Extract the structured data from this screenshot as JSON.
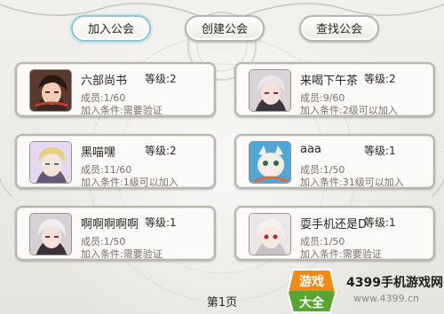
{
  "tabs": [
    {
      "label": "加入公会",
      "active": true
    },
    {
      "label": "创建公会",
      "active": false
    },
    {
      "label": "查找公会",
      "active": false
    }
  ],
  "guilds": [
    {
      "name": "六部尚书",
      "level": "等级:2",
      "members": "成员:1/60",
      "requirement": "加入条件:需要验证"
    },
    {
      "name": "来喝下午茶",
      "level": "等级:2",
      "members": "成员:9/60",
      "requirement": "加入条件:2级可以加入"
    },
    {
      "name": "黑喵嘿",
      "level": "等级:2",
      "members": "成员:11/60",
      "requirement": "加入条件:1级可以加入"
    },
    {
      "name": "aaa",
      "level": "等级:1",
      "members": "成员:1/50",
      "requirement": "加入条件:31级可以加入"
    },
    {
      "name": "啊啊啊啊啊",
      "level": "等级:1",
      "members": "成员:1/50",
      "requirement": "加入条件:需要验证"
    },
    {
      "name": "耍手机还是D",
      "level": "等级:1",
      "members": "成员:1/50",
      "requirement": "加入条件:需要验证"
    }
  ],
  "pager": {
    "label": "第1页"
  },
  "watermark": {
    "badge_top": "游戏",
    "badge_bottom": "大全",
    "title": "4399手机游戏网",
    "url": "www.4399.cn"
  },
  "colors": {
    "accent": "#8fc5d6",
    "watermark_orange": "#f08a17",
    "watermark_green": "#57a62f"
  }
}
